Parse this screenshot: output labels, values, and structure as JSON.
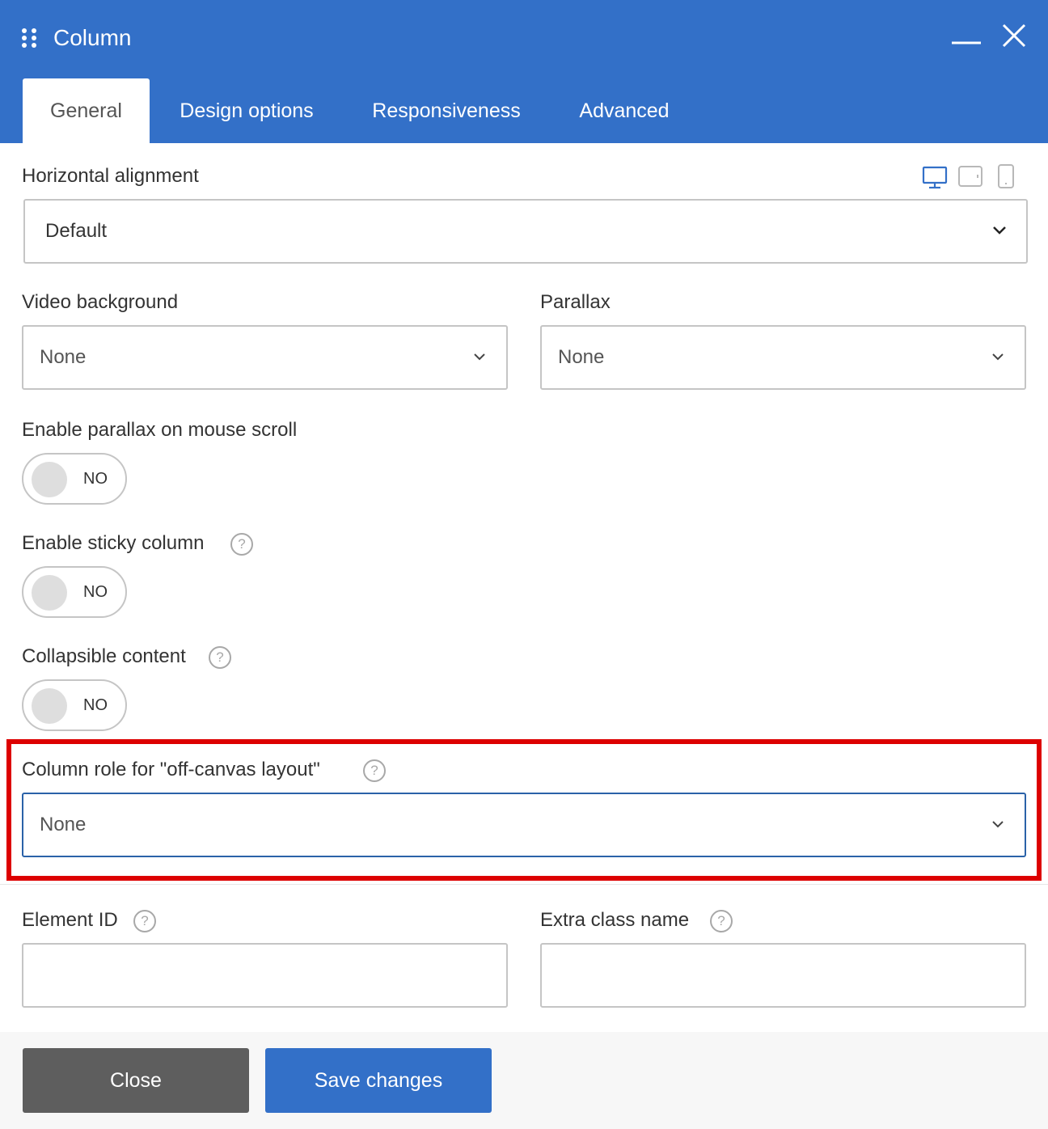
{
  "header": {
    "title": "Column",
    "tabs": [
      {
        "label": "General",
        "active": true
      },
      {
        "label": "Design options",
        "active": false
      },
      {
        "label": "Responsiveness",
        "active": false
      },
      {
        "label": "Advanced",
        "active": false
      }
    ],
    "icons": [
      "drag-handle-icon",
      "minimize-icon",
      "close-icon"
    ]
  },
  "fields": {
    "horizontal_alignment": {
      "label": "Horizontal alignment",
      "value": "Default",
      "devices": [
        "desktop-icon",
        "tablet-icon",
        "mobile-icon"
      ],
      "active_device": "desktop-icon"
    },
    "video_background": {
      "label": "Video background",
      "value": "None"
    },
    "parallax": {
      "label": "Parallax",
      "value": "None"
    },
    "parallax_mouse": {
      "label": "Enable parallax on mouse scroll",
      "state": "NO"
    },
    "sticky_column": {
      "label": "Enable sticky column",
      "state": "NO"
    },
    "collapsible": {
      "label": "Collapsible content",
      "state": "NO"
    },
    "offcanvas_role": {
      "label": "Column role for \"off-canvas layout\"",
      "value": "None"
    },
    "element_id": {
      "label": "Element ID",
      "value": "",
      "placeholder": ""
    },
    "extra_class": {
      "label": "Extra class name",
      "value": "",
      "placeholder": ""
    }
  },
  "help_symbol": "?",
  "footer": {
    "close_label": "Close",
    "save_label": "Save changes"
  },
  "colors": {
    "header_bg": "#3370c8",
    "highlight_border": "#dd0000",
    "close_btn": "#5e5e5e",
    "save_btn": "#3370c8"
  }
}
